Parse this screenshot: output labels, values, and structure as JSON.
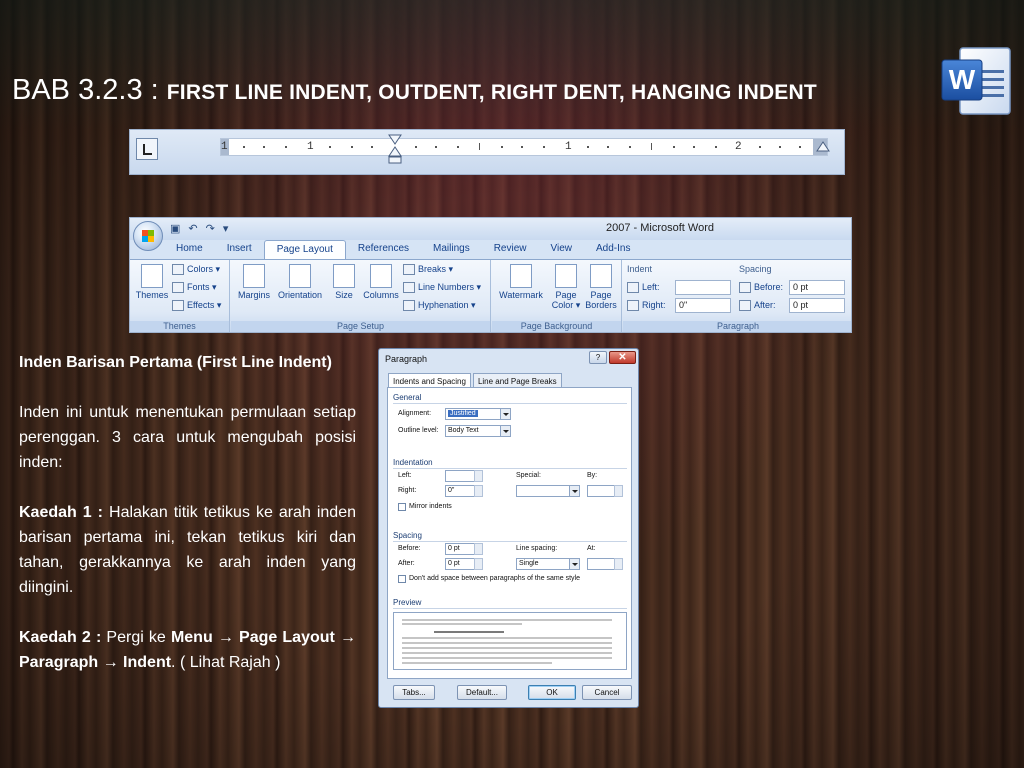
{
  "slide": {
    "title_prefix": "BAB 3.2.3 : ",
    "title_main": "FIRST LINE INDENT, OUTDENT, RIGHT DENT, HANGING INDENT",
    "logo_letter": "W"
  },
  "ruler": {
    "numbers": [
      "1",
      "1",
      "1",
      "2"
    ]
  },
  "ribbon": {
    "window_title": "2007 - Microsoft Word",
    "tabs": [
      "Home",
      "Insert",
      "Page Layout",
      "References",
      "Mailings",
      "Review",
      "View",
      "Add-Ins"
    ],
    "active_tab": "Page Layout",
    "groups": {
      "themes": {
        "label": "Themes",
        "themes_button": "Themes",
        "colors": "Colors",
        "fonts": "Fonts",
        "effects": "Effects"
      },
      "page_setup": {
        "label": "Page Setup",
        "margins": "Margins",
        "orientation": "Orientation",
        "size": "Size",
        "columns": "Columns",
        "breaks": "Breaks",
        "line_numbers": "Line Numbers",
        "hyphenation": "Hyphenation"
      },
      "page_background": {
        "label": "Page Background",
        "watermark": "Watermark",
        "page_color_1": "Page",
        "page_color_2": "Color",
        "page_borders_1": "Page",
        "page_borders_2": "Borders"
      },
      "paragraph": {
        "label": "Paragraph",
        "indent_title": "Indent",
        "spacing_title": "Spacing",
        "left_label": "Left:",
        "left_value": "",
        "right_label": "Right:",
        "right_value": "0\"",
        "before_label": "Before:",
        "before_value": "0 pt",
        "after_label": "After:",
        "after_value": "0 pt"
      }
    }
  },
  "text": {
    "heading": "Inden Barisan Pertama (First Line Indent)",
    "para1": "Inden ini untuk menentukan permulaan setiap perenggan. 3 cara untuk mengubah posisi inden:",
    "kaedah1_label": "Kaedah 1 :",
    "kaedah1_text": " Halakan titik tetikus ke arah inden barisan pertama ini, tekan tetikus kiri dan tahan, gerakkannya ke arah inden yang diingini.",
    "kaedah2_label": "Kaedah 2 :",
    "kaedah2_pergi": " Pergi ke ",
    "kaedah2_menu": "Menu",
    "kaedah2_pagelayout": "Page Layout",
    "kaedah2_paragraph": "Paragraph",
    "kaedah2_indent": "Indent",
    "kaedah2_tail": ". ( Lihat Rajah )",
    "arrow": "→"
  },
  "dialog": {
    "title": "Paragraph",
    "help": "?",
    "close": "✕",
    "tabs": [
      "Indents and Spacing",
      "Line and Page Breaks"
    ],
    "general_label": "General",
    "alignment_label": "Alignment:",
    "alignment_value": "Justified",
    "outline_label": "Outline level:",
    "outline_value": "Body Text",
    "indentation_label": "Indentation",
    "left_label": "Left:",
    "left_value": "",
    "right_label": "Right:",
    "right_value": "0\"",
    "special_label": "Special:",
    "special_value": "",
    "by_label": "By:",
    "by_value": "",
    "mirror_label": "Mirror indents",
    "spacing_label": "Spacing",
    "before_label": "Before:",
    "before_value": "0 pt",
    "after_label": "After:",
    "after_value": "0 pt",
    "line_spacing_label": "Line spacing:",
    "line_spacing_value": "Single",
    "at_label": "At:",
    "at_value": "",
    "dont_add_label": "Don't add space between paragraphs of the same style",
    "preview_label": "Preview",
    "buttons": {
      "tabs": "Tabs...",
      "default": "Default...",
      "ok": "OK",
      "cancel": "Cancel"
    }
  }
}
